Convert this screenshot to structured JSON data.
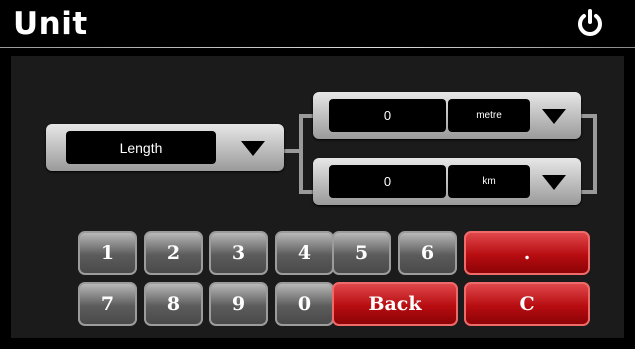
{
  "header": {
    "title": "Unit",
    "power_icon": "power-icon"
  },
  "category": {
    "value": "Length"
  },
  "from": {
    "value": "0",
    "unit": "metre"
  },
  "to": {
    "value": "0",
    "unit": "km"
  },
  "keypad": {
    "k1": "1",
    "k2": "2",
    "k3": "3",
    "k4": "4",
    "k5": "5",
    "k6": "6",
    "kdot": ".",
    "k7": "7",
    "k8": "8",
    "k9": "9",
    "k0": "0",
    "back": "Back",
    "clear": "C"
  },
  "colors": {
    "accent_red": "#b70d11",
    "key_gray": "#5c5c5c",
    "background": "#000000"
  }
}
